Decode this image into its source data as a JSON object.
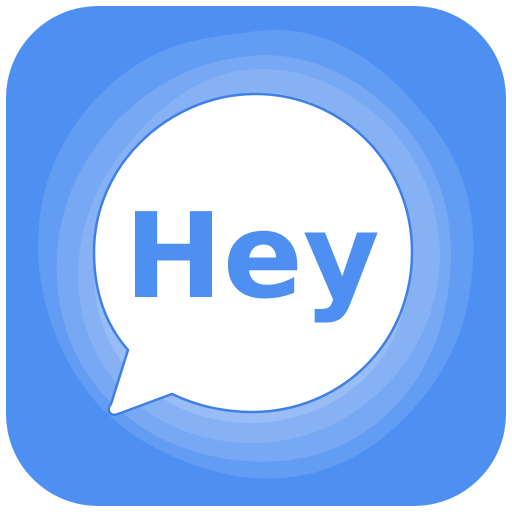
{
  "icon": {
    "text": "Hey",
    "background_color": "#4E8FF2",
    "text_color": "#4E8FF2",
    "bubble_color": "#FFFFFF",
    "icon_name": "speech-bubble-icon"
  }
}
